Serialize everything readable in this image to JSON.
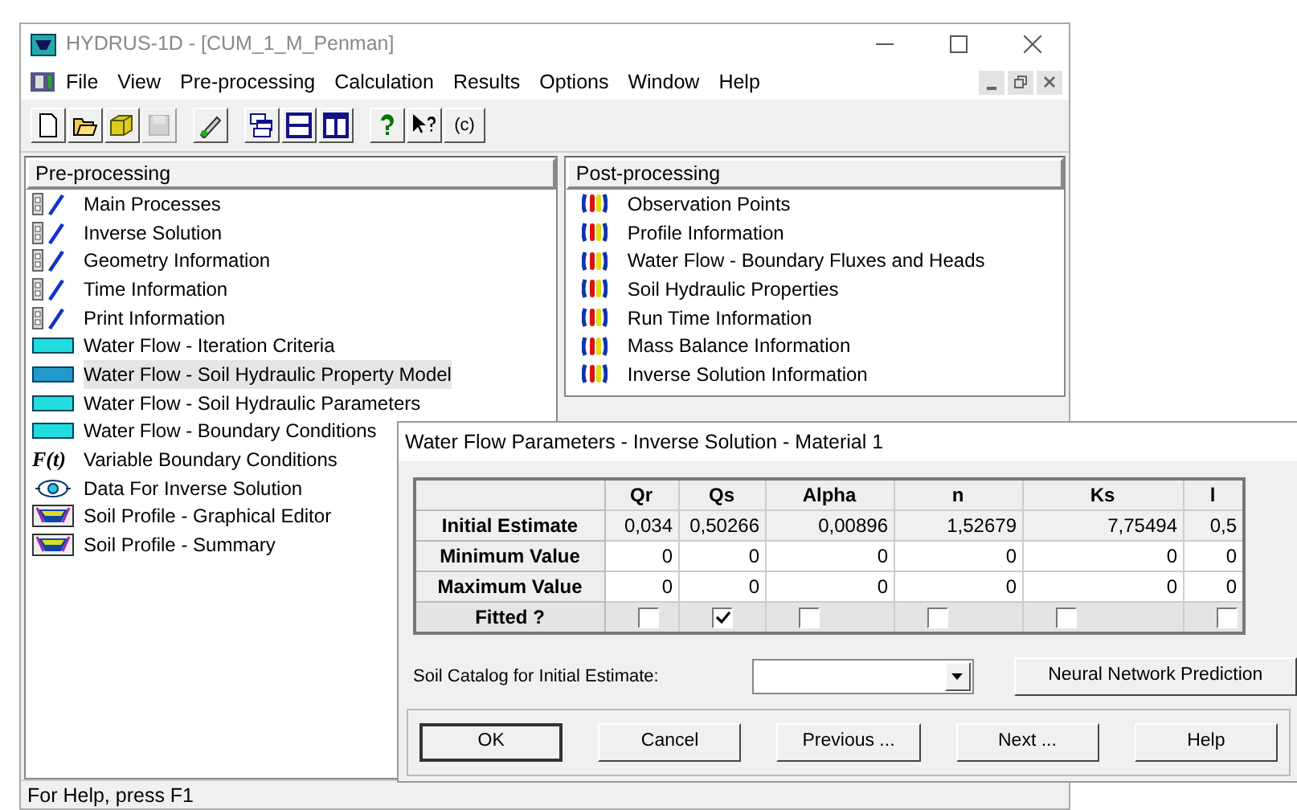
{
  "window": {
    "title": "HYDRUS-1D - [CUM_1_M_Penman]"
  },
  "menu": [
    "File",
    "View",
    "Pre-processing",
    "Calculation",
    "Results",
    "Options",
    "Window",
    "Help"
  ],
  "toolbar": [
    {
      "kind": "new",
      "disabled": false
    },
    {
      "kind": "open",
      "disabled": false
    },
    {
      "kind": "project",
      "disabled": false
    },
    {
      "kind": "save",
      "disabled": true
    },
    {
      "kind": "sep"
    },
    {
      "kind": "graph",
      "disabled": false
    },
    {
      "kind": "sep"
    },
    {
      "kind": "cascade",
      "disabled": false
    },
    {
      "kind": "horizontal",
      "disabled": false
    },
    {
      "kind": "vertical",
      "disabled": false
    },
    {
      "kind": "sep"
    },
    {
      "kind": "help",
      "disabled": false
    },
    {
      "kind": "contexthelp",
      "disabled": false
    },
    {
      "kind": "text",
      "label": "(c)",
      "disabled": false
    }
  ],
  "pre_processing": {
    "title": "Pre-processing",
    "items": [
      {
        "label": "Main Processes",
        "kind": "pencil",
        "selected": false
      },
      {
        "label": "Inverse Solution",
        "kind": "pencil",
        "selected": false
      },
      {
        "label": "Geometry Information",
        "kind": "pencil",
        "selected": false
      },
      {
        "label": "Time Information",
        "kind": "pencil",
        "selected": false
      },
      {
        "label": "Print Information",
        "kind": "pencil",
        "selected": false
      },
      {
        "label": "Water Flow - Iteration Criteria",
        "kind": "water",
        "selected": false
      },
      {
        "label": "Water Flow - Soil Hydraulic Property Model",
        "kind": "water",
        "selected": true
      },
      {
        "label": "Water Flow - Soil Hydraulic Parameters",
        "kind": "water",
        "selected": false
      },
      {
        "label": "Water Flow - Boundary Conditions",
        "kind": "water",
        "selected": false
      },
      {
        "label": "Variable Boundary Conditions",
        "kind": "function",
        "icon_text": "F(t)",
        "selected": false
      },
      {
        "label": "Data For Inverse Solution",
        "kind": "eye",
        "selected": false
      },
      {
        "label": "Soil Profile - Graphical Editor",
        "kind": "profile",
        "selected": false
      },
      {
        "label": "Soil Profile - Summary",
        "kind": "profile",
        "selected": false
      }
    ]
  },
  "post_processing": {
    "title": "Post-processing",
    "items": [
      {
        "label": "Observation Points",
        "selected": false
      },
      {
        "label": "Profile Information",
        "selected": false
      },
      {
        "label": "Water Flow - Boundary Fluxes and Heads",
        "selected": false
      },
      {
        "label": "Soil Hydraulic Properties",
        "selected": false
      },
      {
        "label": "Run Time Information",
        "selected": false
      },
      {
        "label": "Mass Balance Information",
        "selected": false
      },
      {
        "label": "Inverse Solution Information",
        "selected": false
      }
    ]
  },
  "dialog": {
    "title": "Water Flow Parameters - Inverse Solution - Material 1",
    "columns": [
      "Qr",
      "Qs",
      "Alpha",
      "n",
      "Ks",
      "l"
    ],
    "rows": [
      {
        "label": "Initial Estimate",
        "values": [
          "0,034",
          "0,50266",
          "0,00896",
          "1,52679",
          "7,75494",
          "0,5"
        ]
      },
      {
        "label": "Minimum Value",
        "values": [
          "0",
          "0",
          "0",
          "0",
          "0",
          "0"
        ]
      },
      {
        "label": "Maximum Value",
        "values": [
          "0",
          "0",
          "0",
          "0",
          "0",
          "0"
        ]
      }
    ],
    "fitted": {
      "label": "Fitted ?",
      "checked": [
        false,
        true,
        false,
        false,
        false,
        false
      ]
    },
    "catalog_label": "Soil Catalog for Initial Estimate:",
    "neural_button": "Neural Network Prediction",
    "buttons": [
      {
        "label": "OK",
        "default": true
      },
      {
        "label": "Cancel",
        "default": false
      },
      {
        "label": "Previous ...",
        "default": false
      },
      {
        "label": "Next ...",
        "default": false
      },
      {
        "label": "Help",
        "default": false
      }
    ]
  },
  "status_bar": {
    "text": "For Help, press F1"
  }
}
